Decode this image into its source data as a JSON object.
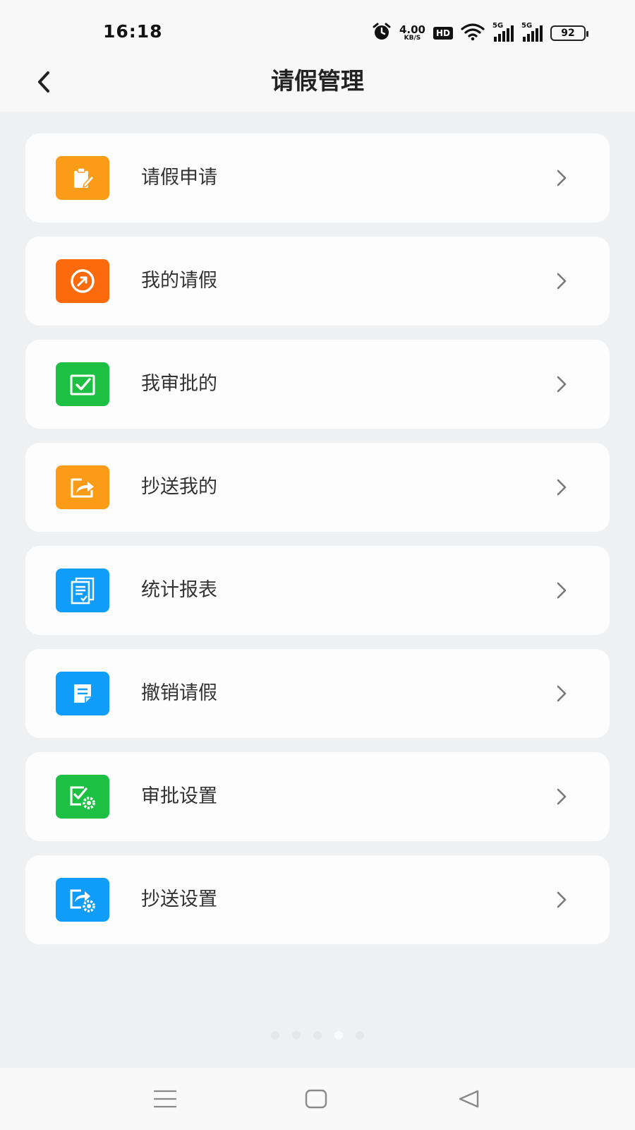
{
  "status_bar": {
    "time": "16:18",
    "network_speed_value": "4.00",
    "network_speed_unit": "KB/S",
    "hd_label": "HD",
    "sim1_label": "5G",
    "sim2_label": "5G",
    "battery_percent": "92",
    "icons": [
      "alarm-icon",
      "hd-icon",
      "wifi-icon",
      "signal-icon",
      "signal-icon",
      "battery-icon"
    ]
  },
  "header": {
    "title": "请假管理",
    "back_icon": "back-arrow-icon"
  },
  "menu": {
    "items": [
      {
        "label": "请假申请",
        "icon": "leave-apply-icon",
        "color": "#fb9c19"
      },
      {
        "label": "我的请假",
        "icon": "my-leave-icon",
        "color": "#fc6a0e"
      },
      {
        "label": "我审批的",
        "icon": "approval-check-icon",
        "color": "#1ec043"
      },
      {
        "label": "抄送我的",
        "icon": "share-icon",
        "color": "#fb9c19"
      },
      {
        "label": "统计报表",
        "icon": "report-icon",
        "color": "#109cf9"
      },
      {
        "label": "撤销请假",
        "icon": "revoke-note-icon",
        "color": "#109cf9"
      },
      {
        "label": "审批设置",
        "icon": "approval-settings-icon",
        "color": "#1ec043"
      },
      {
        "label": "抄送设置",
        "icon": "share-settings-icon",
        "color": "#109cf9"
      }
    ],
    "chevron_icon": "chevron-right-icon"
  },
  "pager": {
    "count": 5,
    "active_index": 3
  },
  "nav": {
    "icons": [
      "menu-icon",
      "home-icon",
      "back-icon"
    ]
  }
}
